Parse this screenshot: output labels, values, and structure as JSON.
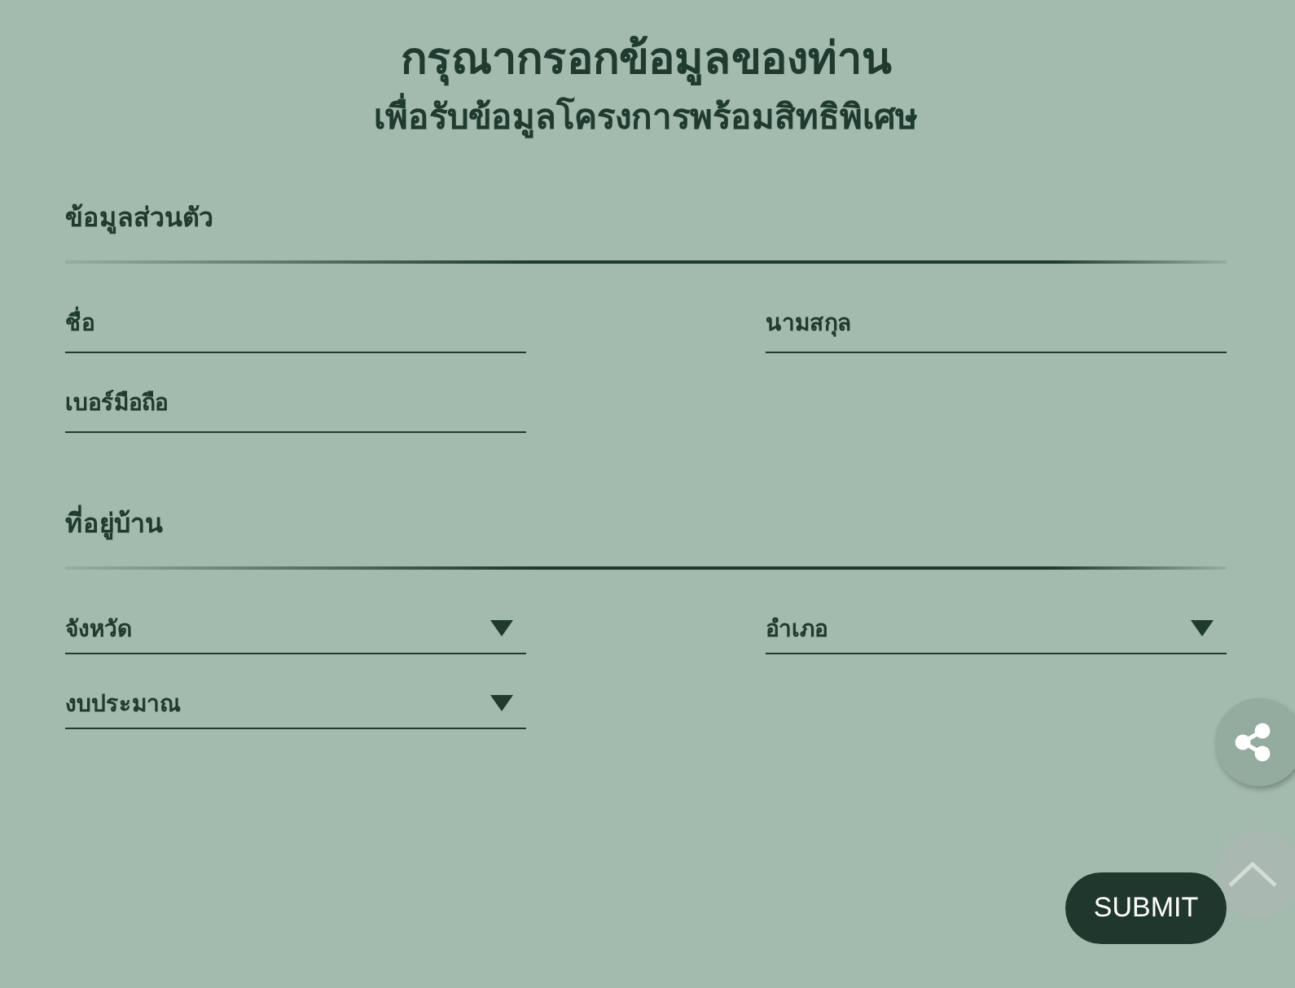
{
  "header": {
    "title": "กรุณากรอกข้อมูลของท่าน",
    "subtitle": "เพื่อรับข้อมูลโครงการพร้อมสิทธิพิเศษ"
  },
  "sections": [
    {
      "title": "ข้อมูลส่วนตัว",
      "fields": [
        {
          "kind": "text",
          "placeholder": "ชื่อ"
        },
        {
          "kind": "text",
          "placeholder": "นามสกุล"
        },
        {
          "kind": "text",
          "placeholder": "เบอร์มือถือ"
        }
      ]
    },
    {
      "title": "ที่อยู่บ้าน",
      "fields": [
        {
          "kind": "select",
          "label": "จังหวัด"
        },
        {
          "kind": "select",
          "label": "อำเภอ"
        },
        {
          "kind": "select",
          "label": "งบประมาณ"
        }
      ]
    }
  ],
  "submit": "SUBMIT"
}
